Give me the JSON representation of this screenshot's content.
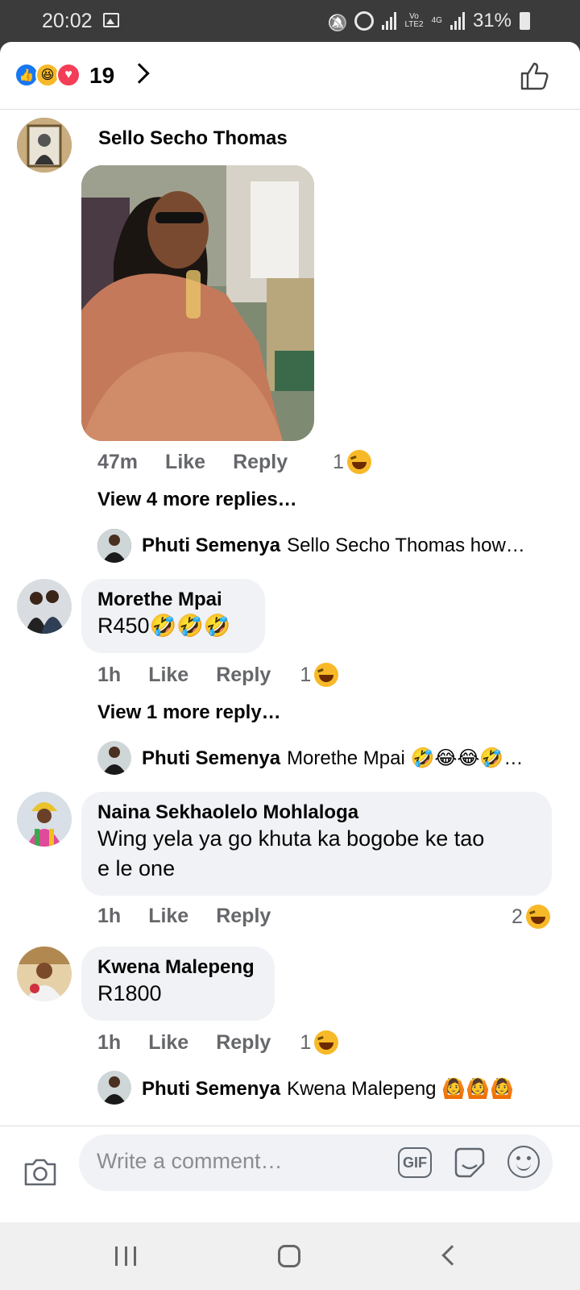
{
  "status": {
    "time": "20:02",
    "battery": "31%",
    "net_tag_top": "Vo",
    "net_tag_bottom": "LTE2",
    "net_4g": "4G"
  },
  "reactions": {
    "count": "19",
    "icons": [
      "like-icon",
      "haha-icon",
      "love-icon"
    ]
  },
  "comments": [
    {
      "name": "Sello Secho Thomas",
      "has_photo": true,
      "time": "47m",
      "like": "Like",
      "reply": "Reply",
      "reaction_count": "1",
      "view_more": "View 4 more replies…",
      "preview_reply": {
        "name": "Phuti Semenya",
        "text": "Sello Secho Thomas how…"
      }
    },
    {
      "name": "Morethe Mpai",
      "text": "R450🤣🤣🤣",
      "time": "1h",
      "like": "Like",
      "reply": "Reply",
      "reaction_count": "1",
      "view_more": "View 1 more reply…",
      "preview_reply": {
        "name": "Phuti Semenya",
        "text": "Morethe Mpai 🤣😂😂🤣…"
      }
    },
    {
      "name": "Naina Sekhaolelo Mohlaloga",
      "text_line1": "Wing yela ya go khuta ka bogobe ke tao",
      "text_line2": "e le one",
      "time": "1h",
      "like": "Like",
      "reply": "Reply",
      "reaction_count": "2"
    },
    {
      "name": "Kwena Malepeng",
      "text": "R1800",
      "time": "1h",
      "like": "Like",
      "reply": "Reply",
      "reaction_count": "1",
      "preview_reply": {
        "name": "Phuti Semenya",
        "text": "Kwena Malepeng 🙆🙆🙆"
      }
    }
  ],
  "composer": {
    "placeholder": "Write a comment…",
    "gif_label": "GIF"
  },
  "colors": {
    "like_blue": "#1877f2",
    "bubble_bg": "#f0f2f5",
    "meta_gray": "#65676b"
  }
}
